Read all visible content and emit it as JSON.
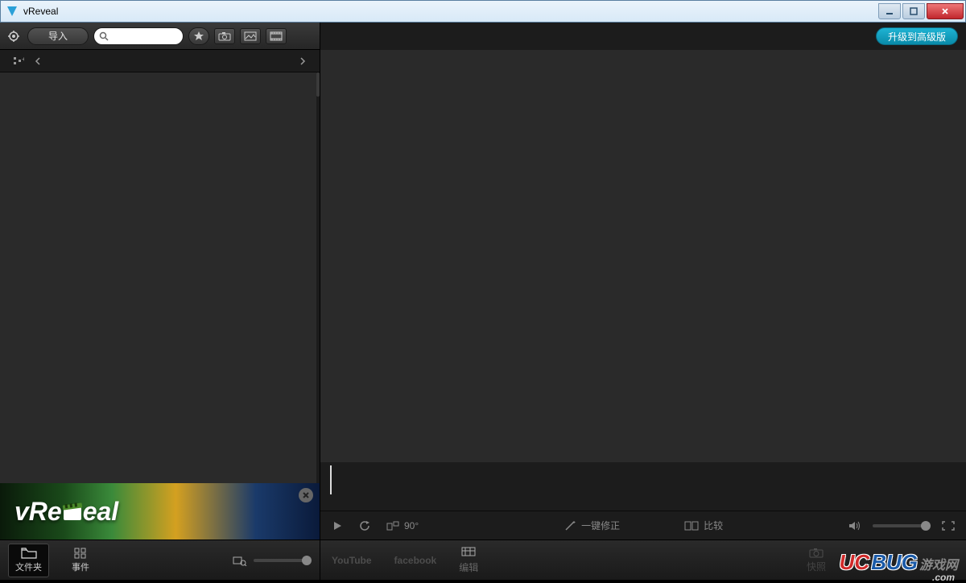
{
  "window": {
    "title": "vReveal"
  },
  "toolbar": {
    "import_label": "导入",
    "search_placeholder": ""
  },
  "upgrade_label": "升级到高级版",
  "promo": {
    "brand": "vReVeal"
  },
  "left_tabs": {
    "folders": "文件夹",
    "events": "事件"
  },
  "controls": {
    "rotate_label": "90°",
    "onekey_label": "一键修正",
    "compare_label": "比较"
  },
  "bottom": {
    "youtube": "YouTube",
    "facebook": "facebook",
    "edit": "编辑",
    "snapshot": "快照"
  },
  "watermark": {
    "uc": "UC",
    "bug": "BUG",
    "cn": "游戏网",
    "com": ".com"
  }
}
